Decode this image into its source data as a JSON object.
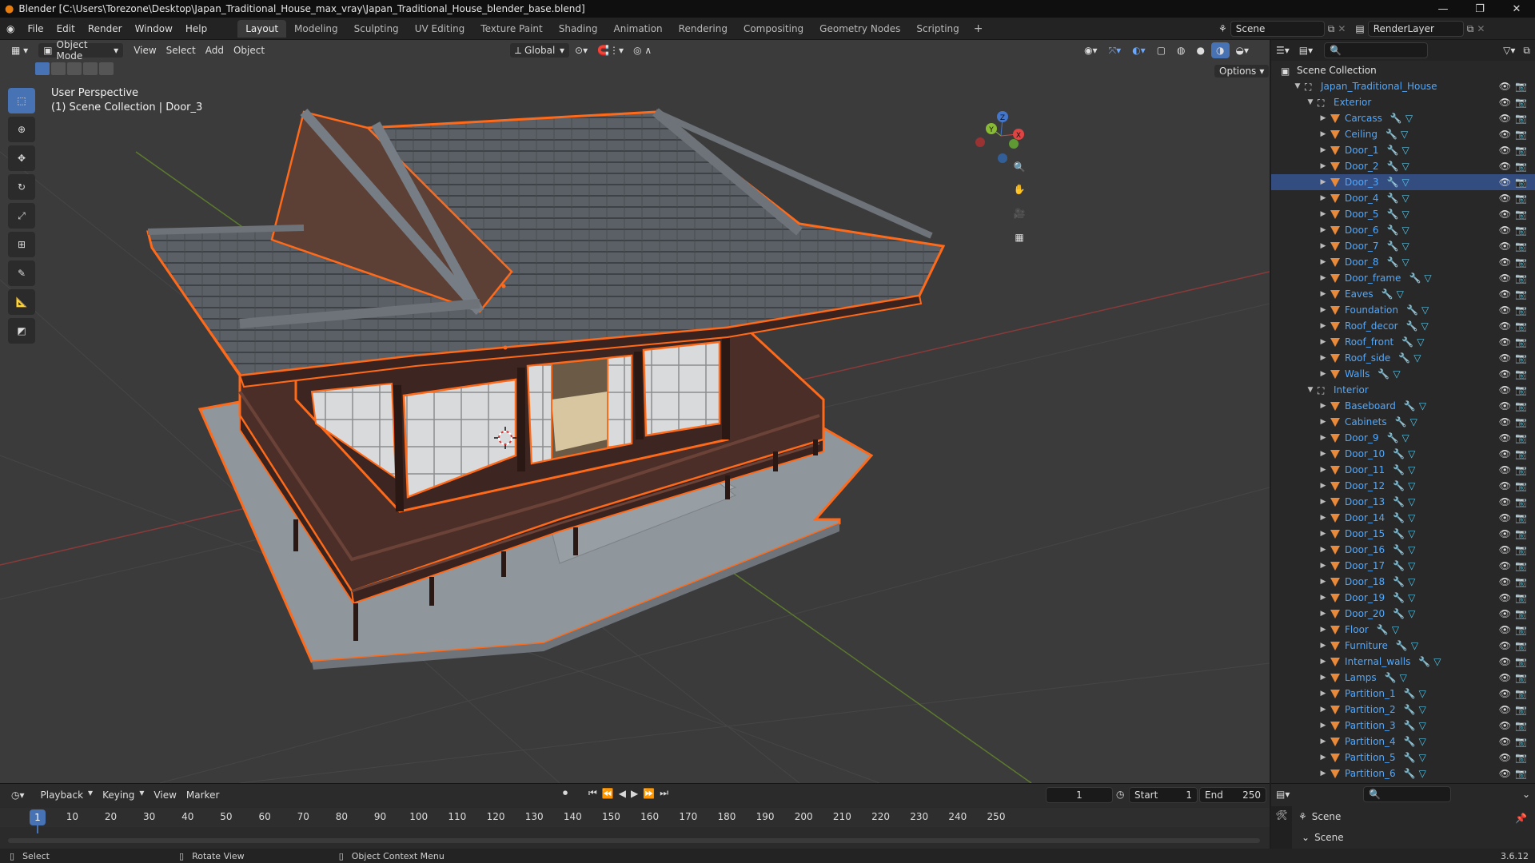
{
  "window": {
    "title": "Blender [C:\\Users\\Torezone\\Desktop\\Japan_Traditional_House_max_vray\\Japan_Traditional_House_blender_base.blend]"
  },
  "menu": [
    "File",
    "Edit",
    "Render",
    "Window",
    "Help"
  ],
  "workspaces": [
    "Layout",
    "Modeling",
    "Sculpting",
    "UV Editing",
    "Texture Paint",
    "Shading",
    "Animation",
    "Rendering",
    "Compositing",
    "Geometry Nodes",
    "Scripting"
  ],
  "active_workspace": "Layout",
  "scene_field": "Scene",
  "renderlayer_field": "RenderLayer",
  "viewport_header": {
    "mode": "Object Mode",
    "menus": [
      "View",
      "Select",
      "Add",
      "Object"
    ],
    "orientation": "Global",
    "options_label": "Options"
  },
  "viewport_overlay": {
    "line1": "User Perspective",
    "line2": "(1) Scene Collection | Door_3"
  },
  "gizmo_axes": {
    "x": "X",
    "y": "Y",
    "z": "Z"
  },
  "outliner": {
    "root": "Scene Collection",
    "collection": "Japan_Traditional_House",
    "groups": [
      {
        "name": "Exterior",
        "items": [
          "Carcass",
          "Ceiling",
          "Door_1",
          "Door_2",
          "Door_3",
          "Door_4",
          "Door_5",
          "Door_6",
          "Door_7",
          "Door_8",
          "Door_frame",
          "Eaves",
          "Foundation",
          "Roof_decor",
          "Roof_front",
          "Roof_side",
          "Walls"
        ]
      },
      {
        "name": "Interior",
        "items": [
          "Baseboard",
          "Cabinets",
          "Door_9",
          "Door_10",
          "Door_11",
          "Door_12",
          "Door_13",
          "Door_14",
          "Door_15",
          "Door_16",
          "Door_17",
          "Door_18",
          "Door_19",
          "Door_20",
          "Floor",
          "Furniture",
          "Internal_walls",
          "Lamps",
          "Partition_1",
          "Partition_2",
          "Partition_3",
          "Partition_4",
          "Partition_5",
          "Partition_6"
        ]
      }
    ],
    "selected": "Door_3"
  },
  "timeline": {
    "menus": [
      "Playback",
      "Keying",
      "View",
      "Marker"
    ],
    "current_frame": "1",
    "start_label": "Start",
    "start_value": "1",
    "end_label": "End",
    "end_value": "250",
    "ticks": [
      "1",
      "10",
      "20",
      "30",
      "40",
      "50",
      "60",
      "70",
      "80",
      "90",
      "100",
      "110",
      "120",
      "130",
      "140",
      "150",
      "160",
      "170",
      "180",
      "190",
      "200",
      "210",
      "220",
      "230",
      "240",
      "250"
    ]
  },
  "properties": {
    "scene_label": "Scene",
    "scene_sub": "Scene"
  },
  "statusbar": {
    "select": "Select",
    "rotate": "Rotate View",
    "context": "Object Context Menu",
    "version": "3.6.12"
  },
  "colors": {
    "selection_outline": "#ff6a1a",
    "outliner_selected": "#334d80",
    "accent": "#4772b3"
  }
}
